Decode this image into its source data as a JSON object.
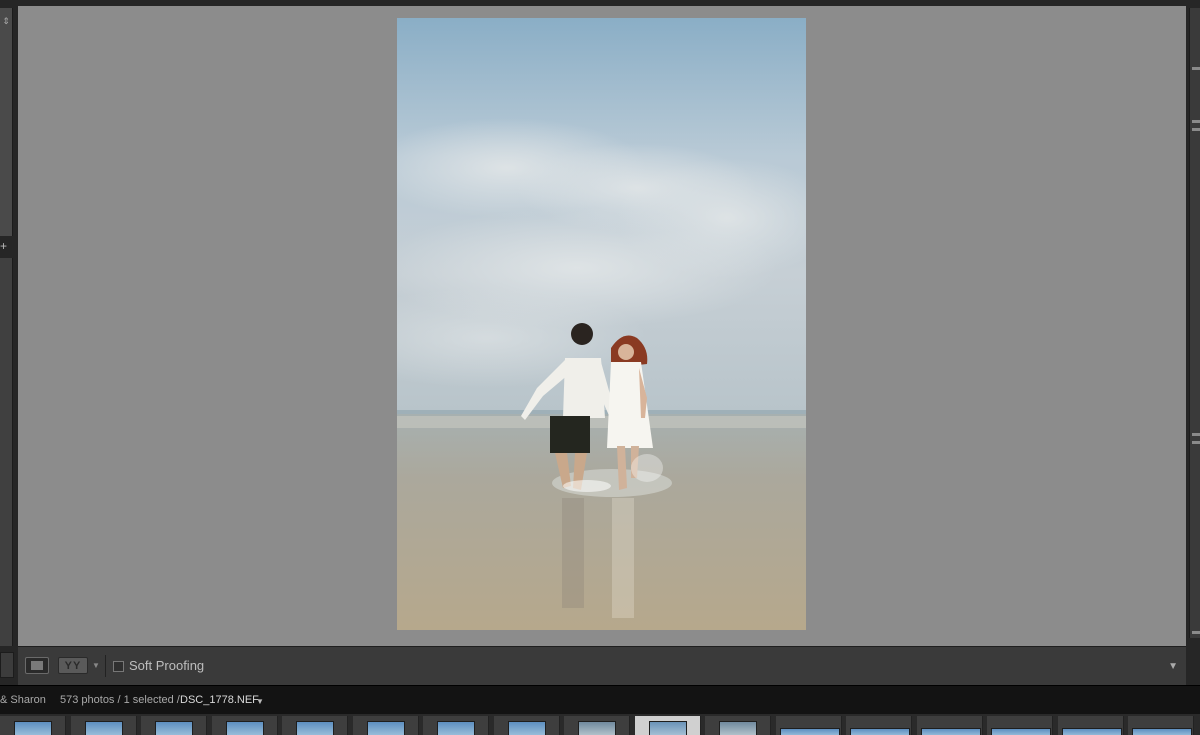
{
  "toolbar": {
    "soft_proofing_label": "Soft Proofing",
    "compare_icon_text": "YY"
  },
  "status_bar": {
    "folder": "& Sharon",
    "count": "573 photos / 1 selected /",
    "filename": "DSC_1778.NEF"
  },
  "filmstrip": {
    "thumbnails": [
      {
        "state": "normal"
      },
      {
        "state": "normal"
      },
      {
        "state": "normal"
      },
      {
        "state": "normal"
      },
      {
        "state": "normal"
      },
      {
        "state": "normal"
      },
      {
        "state": "normal"
      },
      {
        "state": "normal"
      },
      {
        "state": "dark"
      },
      {
        "state": "selected"
      },
      {
        "state": "dark"
      },
      {
        "state": "wide"
      },
      {
        "state": "wide"
      },
      {
        "state": "wide"
      },
      {
        "state": "wide"
      },
      {
        "state": "wide"
      },
      {
        "state": "wide"
      }
    ]
  },
  "colors": {
    "canvas_gray": "#8c8c8c",
    "toolbar_bg": "#3a3a3a",
    "status_bg": "#131313",
    "sky_top": "#8fb0c6",
    "sand": "#b5a487"
  }
}
